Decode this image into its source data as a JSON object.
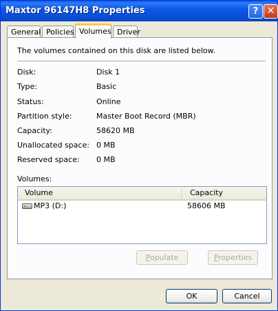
{
  "window": {
    "title": "Maxtor 96147H8 Properties",
    "help_glyph": "?",
    "close_glyph": "✕"
  },
  "tabs": [
    {
      "label": "General"
    },
    {
      "label": "Policies"
    },
    {
      "label": "Volumes",
      "active": true
    },
    {
      "label": "Driver"
    }
  ],
  "panel": {
    "intro": "The volumes contained on this disk are listed below.",
    "fields": [
      {
        "label": "Disk:",
        "value": "Disk 1"
      },
      {
        "label": "Type:",
        "value": "Basic"
      },
      {
        "label": "Status:",
        "value": "Online"
      },
      {
        "label": "Partition style:",
        "value": "Master Boot Record (MBR)"
      },
      {
        "label": "Capacity:",
        "value": "58620 MB"
      },
      {
        "label": "Unallocated space:",
        "value": "0 MB"
      },
      {
        "label": "Reserved space:",
        "value": "0 MB"
      }
    ],
    "volumes_label": "Volumes:",
    "columns": {
      "volume": "Volume",
      "capacity": "Capacity"
    },
    "volumes": [
      {
        "name": "MP3 (D:)",
        "capacity": "58606 MB",
        "icon": "drive-icon"
      }
    ],
    "buttons": {
      "populate": {
        "first": "P",
        "rest": "opulate",
        "enabled": false
      },
      "properties": {
        "first": "P",
        "rest": "roperties",
        "enabled": false
      }
    }
  },
  "footer": {
    "ok": "OK",
    "cancel": "Cancel"
  }
}
